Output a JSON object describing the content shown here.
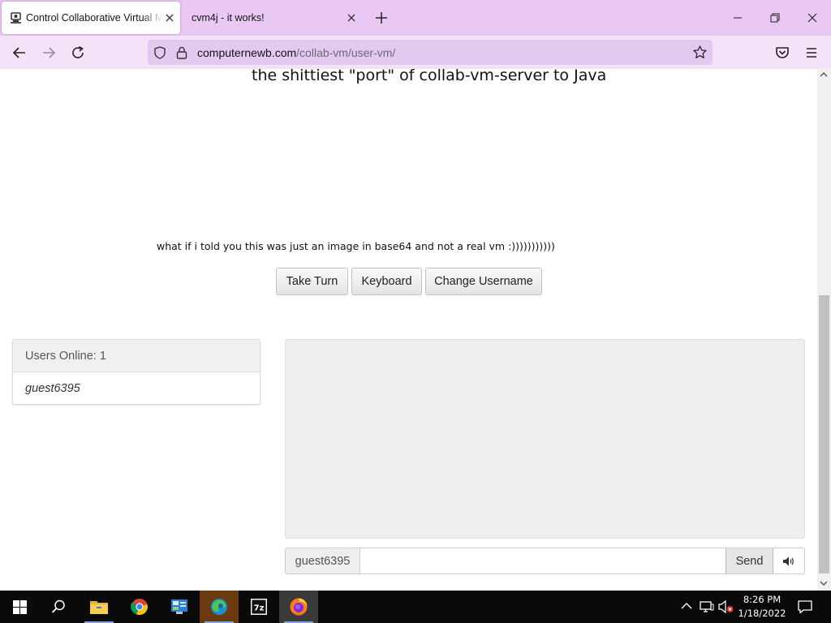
{
  "browser": {
    "tabs": [
      {
        "title": "Control Collaborative Virtual Machines",
        "active": true
      },
      {
        "title": "cvm4j - it works!",
        "active": false
      }
    ],
    "url": {
      "domain": "computernewb.com",
      "path": "/collab-vm/user-vm/"
    }
  },
  "page": {
    "heading": "the shittiest \"port\" of collab-vm-server to Java",
    "caption": "what if i told you this was just an image in base64 and not a real vm :)))))))))))",
    "buttons": {
      "take_turn": "Take Turn",
      "keyboard": "Keyboard",
      "change_username": "Change Username"
    },
    "users_panel": {
      "title": "Users Online: 1",
      "users": [
        "guest6395"
      ]
    },
    "chat": {
      "username": "guest6395",
      "input_value": "",
      "send_label": "Send"
    }
  },
  "taskbar": {
    "apps": [
      "start",
      "search",
      "file-explorer",
      "chrome",
      "control-panel",
      "edge",
      "7-zip",
      "firefox"
    ],
    "clock": {
      "time": "8:26 PM",
      "date": "1/18/2022"
    }
  },
  "colors": {
    "tab_strip": "#e9c8f3",
    "toolbar": "#f3e2f8",
    "urlbar": "#e3c9ef",
    "taskbar": "#0a0a0a"
  }
}
